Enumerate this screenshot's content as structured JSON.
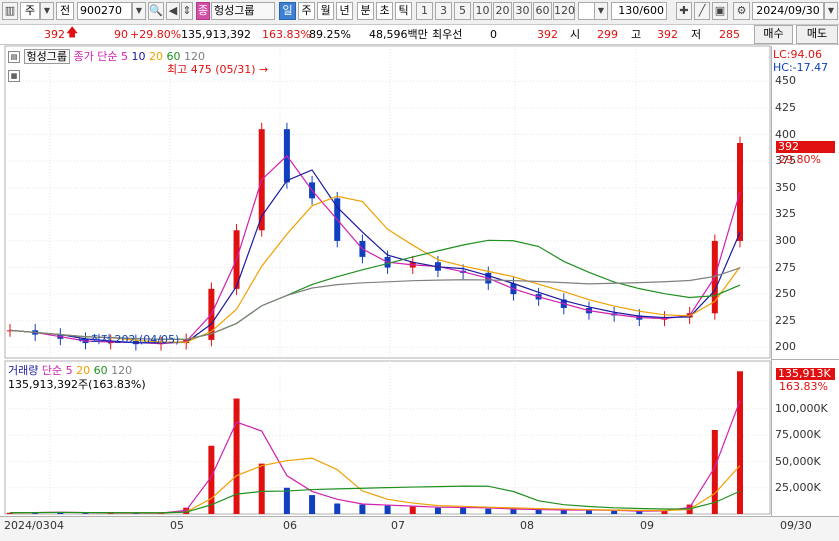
{
  "toolbar": {
    "market": "주",
    "prev": "전",
    "code": "900270",
    "name": "헝성그룹",
    "period_day": "일",
    "period_week": "주",
    "period_month": "월",
    "period_year": "년",
    "period_min": "분",
    "period_sec": "초",
    "period_tick": "틱",
    "intervals": [
      "1",
      "3",
      "5",
      "10",
      "20",
      "30",
      "60",
      "120"
    ],
    "count": "130/600",
    "date": "2024/09/30",
    "buy": "매수",
    "sell": "매도"
  },
  "quote": {
    "price": "392",
    "change": "90",
    "change_pct": "+29.80%",
    "volume": "135,913,392",
    "vol_ratio": "163.83%",
    "turnover_pct": "89.25%",
    "amount": "48,596백만",
    "best_bid_label": "최우선",
    "best_bid": "0",
    "best_ask": "392",
    "open_label": "시",
    "open": "299",
    "high_label": "고",
    "high": "392",
    "low_label": "저",
    "low": "285"
  },
  "price_panel": {
    "name": "헝성그룹",
    "ma_label": "종가 단순",
    "ma_periods": [
      "5",
      "10",
      "20",
      "60",
      "120"
    ],
    "lc": "LC:94.06",
    "hc": "HC:-17.47",
    "high_note": "최고 475 (05/31)",
    "low_note": "최저 202 (04/05)",
    "current_tag": "392",
    "current_pct": "29.80%",
    "ticks": [
      "450",
      "425",
      "400",
      "375",
      "350",
      "325",
      "300",
      "275",
      "250",
      "225",
      "200"
    ]
  },
  "volume_panel": {
    "label": "거래량",
    "ma_label": "단순",
    "ma_periods": [
      "5",
      "20",
      "60",
      "120"
    ],
    "value_text": "135,913,392주(163.83%)",
    "current_tag": "135,913K",
    "current_pct": "163.83%",
    "ticks": [
      "100,000K",
      "75,000K",
      "50,000K",
      "25,000K"
    ]
  },
  "dates": {
    "start": "2024/03",
    "labels": [
      "04",
      "05",
      "06",
      "07",
      "08",
      "09"
    ],
    "end": "09/30"
  },
  "colors": {
    "up": "#e01010",
    "down": "#1040c0",
    "ma5": "#d020b0",
    "ma10": "#1a1aa0",
    "ma20": "#f0a000",
    "ma60": "#209020",
    "ma120": "#808080"
  },
  "chart_data": {
    "type": "candlestick",
    "title": "헝성그룹",
    "ylim": [
      190,
      470
    ],
    "x": [
      "2024/03/25",
      "2024/04/01",
      "2024/04/08",
      "2024/04/15",
      "2024/04/22",
      "2024/04/29",
      "2024/05/06",
      "2024/05/13",
      "2024/05/20",
      "2024/05/27",
      "2024/05/31",
      "2024/06/05",
      "2024/06/10",
      "2024/06/17",
      "2024/06/24",
      "2024/07/01",
      "2024/07/08",
      "2024/07/15",
      "2024/07/22",
      "2024/07/29",
      "2024/08/05",
      "2024/08/12",
      "2024/08/19",
      "2024/08/26",
      "2024/09/02",
      "2024/09/09",
      "2024/09/16",
      "2024/09/23",
      "2024/09/27",
      "2024/09/30"
    ],
    "close": [
      216,
      212,
      208,
      204,
      206,
      203,
      204,
      207,
      255,
      310,
      405,
      355,
      340,
      300,
      285,
      275,
      280,
      272,
      270,
      260,
      250,
      245,
      237,
      232,
      230,
      226,
      228,
      232,
      300,
      392
    ],
    "volume_k": [
      1200,
      1500,
      1800,
      900,
      1100,
      800,
      900,
      6000,
      65000,
      110000,
      48000,
      25000,
      18000,
      10000,
      9000,
      8000,
      7000,
      6000,
      6500,
      5000,
      4500,
      4000,
      3500,
      4000,
      3000,
      2500,
      3500,
      9000,
      80000,
      135913
    ]
  }
}
